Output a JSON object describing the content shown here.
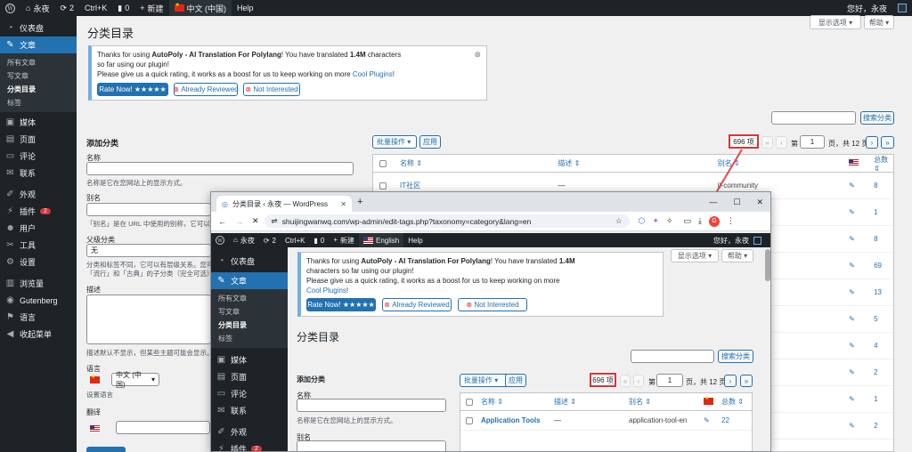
{
  "admin_bar": {
    "site_name": "永夜",
    "updates_count": "2",
    "shortcut": "Ctrl+K",
    "comments_count": "0",
    "new_label": "新建",
    "language": "中文 (中国)",
    "help": "Help",
    "greeting": "您好，永夜"
  },
  "sidebar": {
    "items": [
      {
        "label": "仪表盘",
        "icon": "dashboard-icon"
      },
      {
        "label": "文章",
        "icon": "pin-icon"
      },
      {
        "label": "媒体",
        "icon": "media-icon"
      },
      {
        "label": "页面",
        "icon": "page-icon"
      },
      {
        "label": "评论",
        "icon": "comment-icon"
      },
      {
        "label": "联系",
        "icon": "mail-icon"
      },
      {
        "label": "外观",
        "icon": "brush-icon"
      },
      {
        "label": "插件",
        "icon": "plugin-icon",
        "badge": "2"
      },
      {
        "label": "用户",
        "icon": "user-icon"
      },
      {
        "label": "工具",
        "icon": "wrench-icon"
      },
      {
        "label": "设置",
        "icon": "settings-icon"
      },
      {
        "label": "浏览量",
        "icon": "chart-icon"
      },
      {
        "label": "Gutenberg",
        "icon": "gutenberg-icon"
      },
      {
        "label": "语言",
        "icon": "translate-icon"
      },
      {
        "label": "收起菜单",
        "icon": "collapse-icon"
      }
    ],
    "submenu": [
      "所有文章",
      "写文章",
      "分类目录",
      "标签"
    ]
  },
  "screen_options": "显示选项",
  "help_button": "帮助",
  "page_title": "分类目录",
  "notice": {
    "line1_a": "Thanks for using ",
    "plugin_name": "AutoPoly - AI Translation For Polylang",
    "line1_b": "! You have translated ",
    "chars": "1.4M",
    "line1_c": " characters",
    "line2": "so far using our plugin!",
    "line3_a": "Please give us a quick rating, it works as a boost for us to keep working on more ",
    "cool_plugins": "Cool Plugins",
    "line3_b": "!",
    "rate_button": "Rate Now! ★★★★★",
    "reviewed_button": "Already Reviewed",
    "not_interested_button": "Not Interested"
  },
  "search_button": "搜索分类",
  "add_form": {
    "heading": "添加分类",
    "name_label": "名称",
    "name_hint": "名称是它在您网站上的显示方式。",
    "slug_label": "别名",
    "slug_hint": "「别名」是在 URL 中使用的别称，它可以令URL更美观。通常使用小写，只能包含字母，数字和连字符（-）。",
    "parent_label": "父级分类",
    "parent_value": "无",
    "parent_hint1": "分类和标签不同，它可以有层级关系。您可以有一个「音乐」分类目录，在这个目录下可以有叫做",
    "parent_hint2": "「流行」和「古典」的子分类（完全可选）。",
    "desc_label": "描述",
    "desc_hint": "描述默认不显示，但某些主题可能会显示。",
    "lang_label": "语言",
    "lang_value": "中文 (中国)",
    "lang_hint": "设置语言",
    "translate_label": "翻译"
  },
  "table": {
    "bulk_action": "批量操作",
    "apply": "应用",
    "count": "696 项",
    "first": "«",
    "prev": "‹",
    "page_prefix": "第",
    "page": "1",
    "page_suffix": "页，共 12 页",
    "next": "›",
    "last": "»",
    "col_name": "名称",
    "col_desc": "描述",
    "col_slug": "别名",
    "col_count": "总数",
    "rows": [
      {
        "name": "IT社区",
        "desc": "—",
        "slug": "it-community",
        "count": "8"
      },
      {
        "name": "",
        "desc": "",
        "slug": "",
        "count": "1"
      },
      {
        "name": "",
        "desc": "",
        "slug": "",
        "count": "8"
      },
      {
        "name": "",
        "desc": "",
        "slug": "",
        "count": "69"
      },
      {
        "name": "",
        "desc": "",
        "slug": "",
        "count": "13"
      },
      {
        "name": "",
        "desc": "",
        "slug": "",
        "count": "5"
      },
      {
        "name": "",
        "desc": "",
        "slug": "",
        "count": "4"
      },
      {
        "name": "",
        "desc": "",
        "slug": "",
        "count": "2"
      },
      {
        "name": "",
        "desc": "",
        "slug": "",
        "count": "1"
      },
      {
        "name": "",
        "desc": "",
        "slug": "",
        "count": "2"
      }
    ]
  },
  "browser": {
    "tab_title": "分类目录 ‹ 永夜 — WordPress",
    "new_tab": "+",
    "url": "shuijingwanwq.com/wp-admin/edit-tags.php?taxonomy=category&lang=en",
    "language": "English",
    "help": "Help",
    "greeting": "您好，永夜",
    "notice_line1_b": "! You have translated ",
    "notice_line1_c": "1.4M",
    "notice_line2": "characters so far using our plugin!",
    "notice_line3": "Please give us a quick rating, it works as a boost for us to keep working on more",
    "notice_line4": "Cool Plugins",
    "notice_line4_b": "!",
    "row_name": "Application Tools",
    "row_desc": "—",
    "row_slug": "application-tool-en",
    "row_count": "22",
    "profile_initial": "G"
  },
  "colors": {
    "accent": "#2271b1",
    "admin_bar": "#1d2327",
    "highlight": "#d63638"
  }
}
